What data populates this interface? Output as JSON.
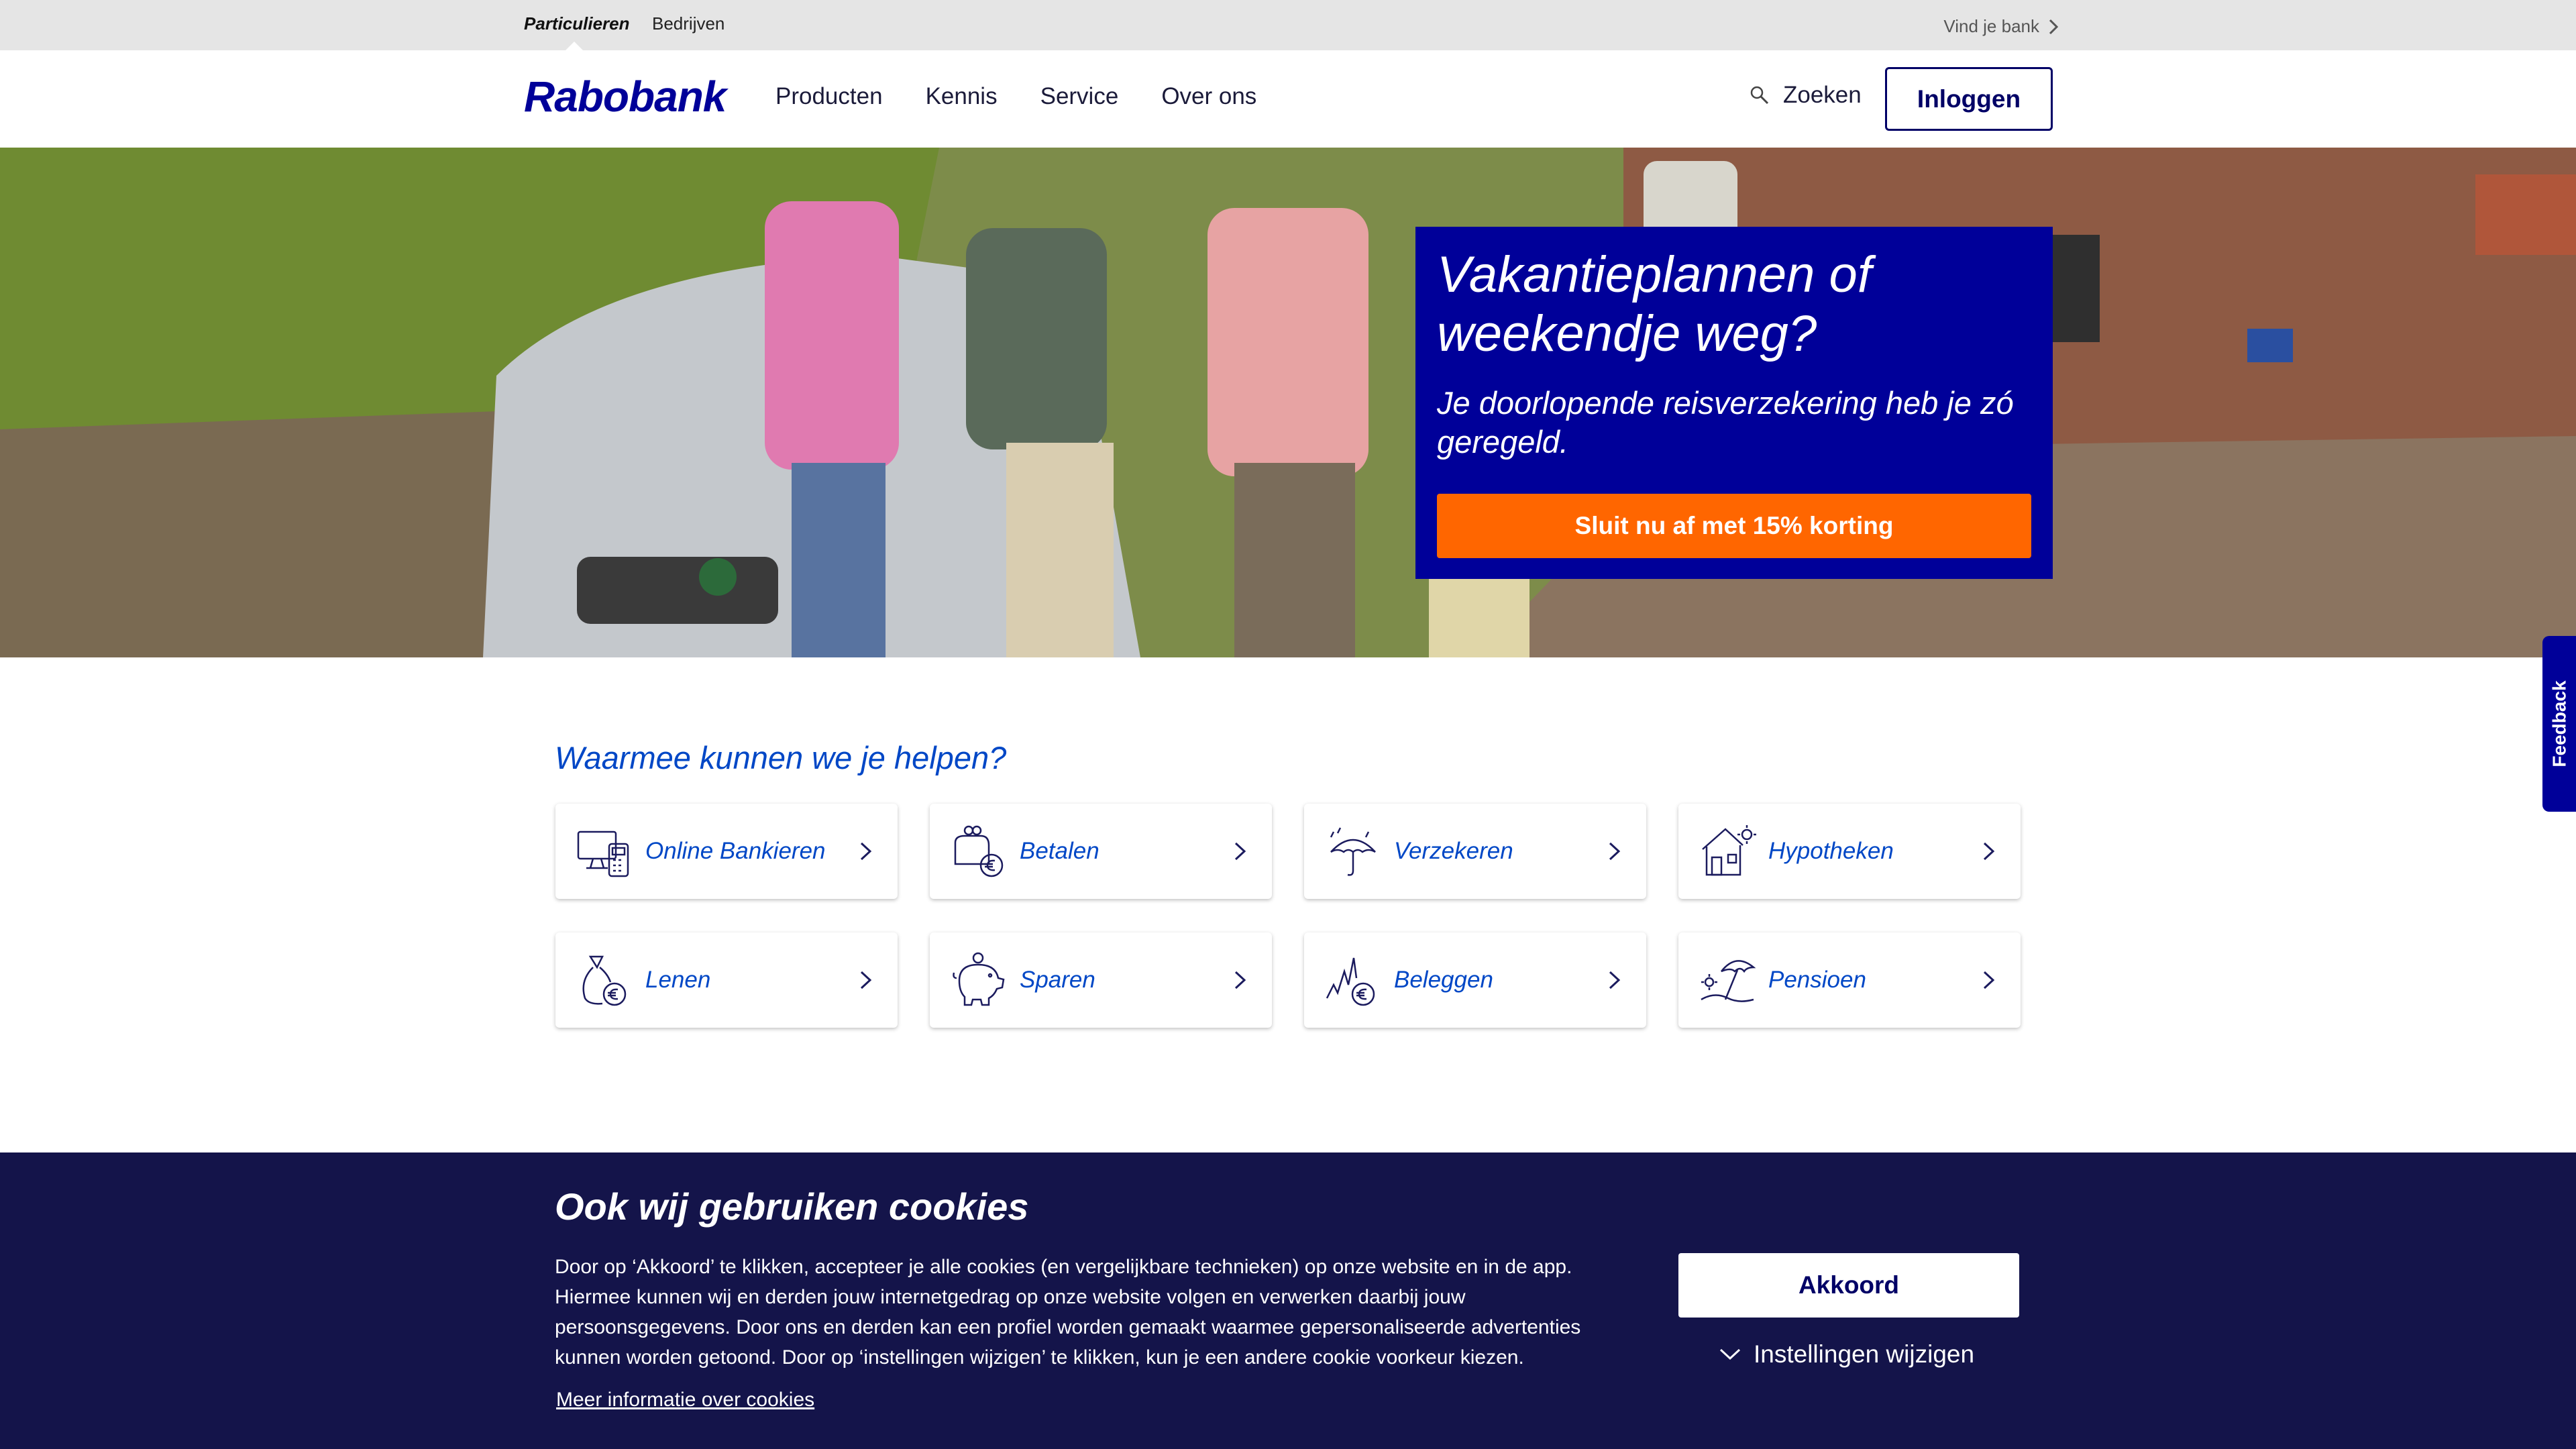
{
  "topbar": {
    "segments": [
      "Particulieren",
      "Bedrijven"
    ],
    "find_bank": "Vind je bank"
  },
  "header": {
    "logo": "Rabobank",
    "nav": [
      "Producten",
      "Kennis",
      "Service",
      "Over ons"
    ],
    "search_label": "Zoeken",
    "login_label": "Inloggen"
  },
  "hero": {
    "title": "Vakantieplannen of weekendje weg?",
    "subtitle": "Je doorlopende reisverzekering heb je zó geregeld.",
    "cta": "Sluit nu af met 15% korting",
    "colors": {
      "panel": "#000099",
      "cta": "#ff6600"
    }
  },
  "feedback": {
    "label": "Feedback"
  },
  "help": {
    "title": "Waarmee kunnen we je helpen?",
    "tiles": [
      {
        "label": "Online Bankieren",
        "icon": "computer-card-reader-icon"
      },
      {
        "label": "Betalen",
        "icon": "wallet-euro-icon"
      },
      {
        "label": "Verzekeren",
        "icon": "umbrella-icon"
      },
      {
        "label": "Hypotheken",
        "icon": "house-icon"
      },
      {
        "label": "Lenen",
        "icon": "money-bag-euro-icon"
      },
      {
        "label": "Sparen",
        "icon": "piggy-bank-icon"
      },
      {
        "label": "Beleggen",
        "icon": "chart-euro-icon"
      },
      {
        "label": "Pensioen",
        "icon": "beach-umbrella-icon"
      }
    ]
  },
  "cookie": {
    "title": "Ook wij gebruiken cookies",
    "text": "Door op ‘Akkoord’ te klikken, accepteer je alle cookies (en vergelijkbare technieken) op onze website en in de app. Hiermee kunnen wij en derden jouw internetgedrag op onze website volgen en verwerken daarbij jouw persoonsgegevens. Door ons en derden kan een profiel worden gemaakt waarmee gepersonaliseerde advertenties kunnen worden getoond. Door op ‘instellingen wijzigen’ te klikken, kun je een andere cookie voorkeur kiezen.",
    "more_link": "Meer informatie over cookies",
    "accept": "Akkoord",
    "settings": "Instellingen wijzigen",
    "colors": {
      "background": "#14144a"
    }
  }
}
